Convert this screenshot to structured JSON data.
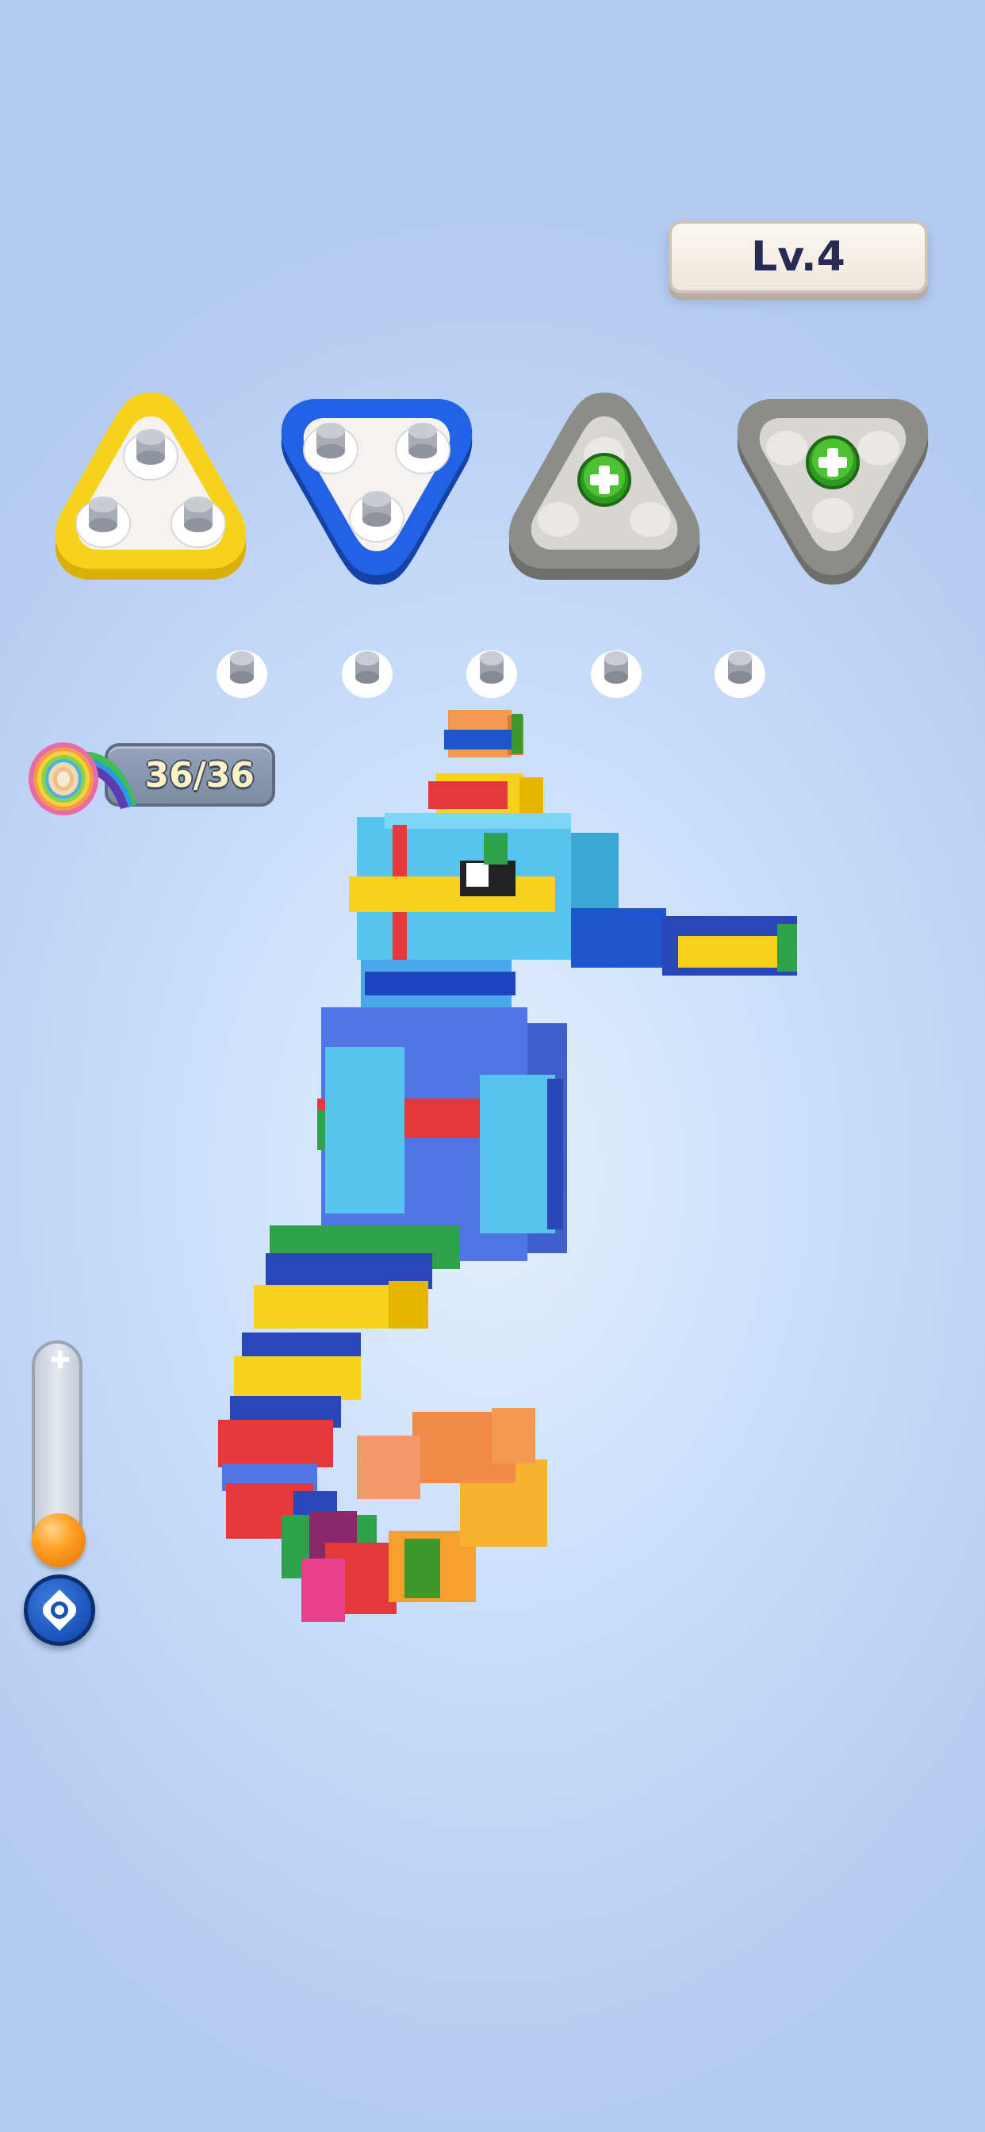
{
  "level": {
    "label": "Lv.4"
  },
  "holders": [
    {
      "name": "yellow",
      "color": "#f6cf13",
      "state": "active",
      "pegs": 3
    },
    {
      "name": "blue",
      "color": "#1f59d8",
      "state": "active",
      "pegs": 3
    },
    {
      "name": "locked-1",
      "color": "#8a8a86",
      "state": "locked",
      "icon": "plus-icon"
    },
    {
      "name": "locked-2",
      "color": "#8a8a86",
      "state": "locked",
      "icon": "plus-icon"
    }
  ],
  "queue_slots": 5,
  "tape": {
    "count": "36/36",
    "icon": "rainbow-tape-roll-icon"
  },
  "zoom": {
    "level": 0.0,
    "plus_icon": "plus-icon",
    "recenter_icon": "target-icon"
  },
  "model": {
    "subject": "seahorse",
    "icon": "block-seahorse-model"
  }
}
